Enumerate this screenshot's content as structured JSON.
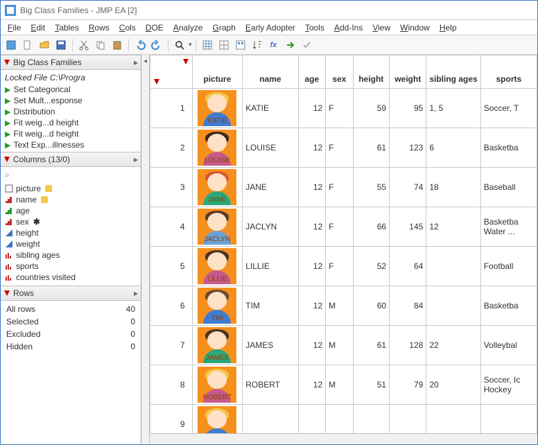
{
  "window": {
    "title": "Big Class Families - JMP EA [2]"
  },
  "menu": [
    "File",
    "Edit",
    "Tables",
    "Rows",
    "Cols",
    "DOE",
    "Analyze",
    "Graph",
    "Early Adopter",
    "Tools",
    "Add-Ins",
    "View",
    "Window",
    "Help"
  ],
  "left": {
    "panel1": {
      "title": "Big Class Families",
      "locked": "Locked File  C:\\Progra",
      "scripts": [
        "Set Categorical",
        "Set Mult...esponse",
        "Distribution",
        "Fit weig...d height",
        "Fit weig...d height",
        "Text Exp...illnesses"
      ]
    },
    "panel2": {
      "title": "Columns (13/0)",
      "columns": [
        {
          "name": "picture",
          "type": "expr",
          "linked": true
        },
        {
          "name": "name",
          "type": "char",
          "linked": true
        },
        {
          "name": "age",
          "type": "ord"
        },
        {
          "name": "sex",
          "type": "char",
          "star": true
        },
        {
          "name": "height",
          "type": "cont"
        },
        {
          "name": "weight",
          "type": "cont"
        },
        {
          "name": "sibling ages",
          "type": "char2"
        },
        {
          "name": "sports",
          "type": "char2"
        },
        {
          "name": "countries visited",
          "type": "char2"
        }
      ]
    },
    "panel3": {
      "title": "Rows",
      "stats": [
        {
          "label": "All rows",
          "value": "40"
        },
        {
          "label": "Selected",
          "value": "0"
        },
        {
          "label": "Excluded",
          "value": "0"
        },
        {
          "label": "Hidden",
          "value": "0"
        }
      ]
    }
  },
  "table": {
    "headers": [
      "",
      "picture",
      "name",
      "age",
      "sex",
      "height",
      "weight",
      "sibling ages",
      "sports"
    ],
    "rows": [
      {
        "n": "1",
        "name": "KATIE",
        "age": "12",
        "sex": "F",
        "height": "59",
        "weight": "95",
        "sib": "1, 5",
        "sports": "Soccer, T",
        "hair": "#f4c64a",
        "body": "#3f7bd1"
      },
      {
        "n": "2",
        "name": "LOUISE",
        "age": "12",
        "sex": "F",
        "height": "61",
        "weight": "123",
        "sib": "6",
        "sports": "Basketba",
        "hair": "#3b2a20",
        "body": "#c65b8a"
      },
      {
        "n": "3",
        "name": "JANE",
        "age": "12",
        "sex": "F",
        "height": "55",
        "weight": "74",
        "sib": "18",
        "sports": "Baseball",
        "hair": "#d85a2c",
        "body": "#2aa87a"
      },
      {
        "n": "4",
        "name": "JACLYN",
        "age": "12",
        "sex": "F",
        "height": "66",
        "weight": "145",
        "sib": "12",
        "sports": "Basketba\nWater ...",
        "hair": "#5a3a24",
        "body": "#6aa0d8"
      },
      {
        "n": "5",
        "name": "LILLIE",
        "age": "12",
        "sex": "F",
        "height": "52",
        "weight": "64",
        "sib": "",
        "sports": "Football",
        "hair": "#4a3422",
        "body": "#c65b8a"
      },
      {
        "n": "6",
        "name": "TIM",
        "age": "12",
        "sex": "M",
        "height": "60",
        "weight": "84",
        "sib": "",
        "sports": "Basketba",
        "hair": "#6a4a30",
        "body": "#3f7bd1"
      },
      {
        "n": "7",
        "name": "JAMES",
        "age": "12",
        "sex": "M",
        "height": "61",
        "weight": "128",
        "sib": "22",
        "sports": "Volleybal",
        "hair": "#4a3422",
        "body": "#2aa87a"
      },
      {
        "n": "8",
        "name": "ROBERT",
        "age": "12",
        "sex": "M",
        "height": "51",
        "weight": "79",
        "sib": "20",
        "sports": "Soccer, Ic\nHockey",
        "hair": "#f4c64a",
        "body": "#c65b8a"
      },
      {
        "n": "9",
        "name": "",
        "age": "",
        "sex": "",
        "height": "",
        "weight": "",
        "sib": "",
        "sports": "",
        "hair": "#f4c64a",
        "body": "#3f7bd1"
      }
    ]
  }
}
